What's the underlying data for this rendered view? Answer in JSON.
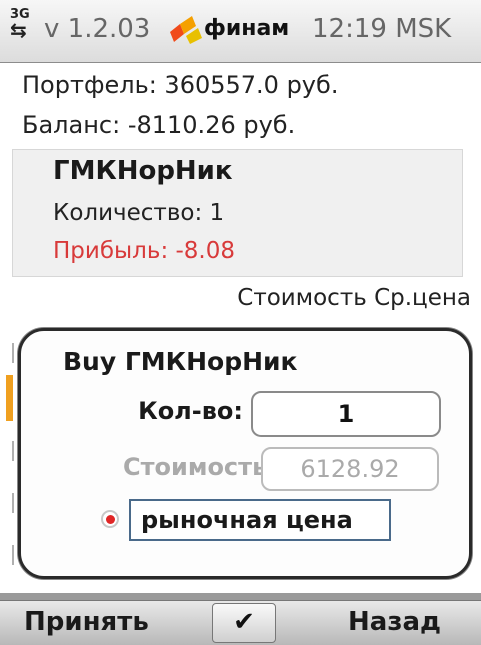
{
  "status_bar": {
    "network": "3G",
    "network_arrows": "⇆",
    "version": "v 1.2.03",
    "brand": "финам",
    "clock": "12:19 MSK",
    "logo_colors": [
      "#f04a1a",
      "#f5a000",
      "#e8c000"
    ]
  },
  "portfolio": {
    "portfolio_line": "Портфель: 360557.0 руб.",
    "balance_line": "Баланс: -8110.26 руб."
  },
  "position": {
    "ticker": "ГМКНорНик",
    "quantity_line": "Количество: 1",
    "profit_line": "Прибыль: -8.08"
  },
  "columns_header": "Стоимость Ср.цена",
  "order_dialog": {
    "title": "Buy ГМКНорНик",
    "qty_label": "Кол-во:",
    "qty_value": "1",
    "cost_label": "Стоимость:",
    "cost_value": "6128.92",
    "market_price_label": "рыночная цена",
    "market_price_selected": true
  },
  "softkeys": {
    "left": "Принять",
    "middle": "✔",
    "right": "Назад"
  }
}
